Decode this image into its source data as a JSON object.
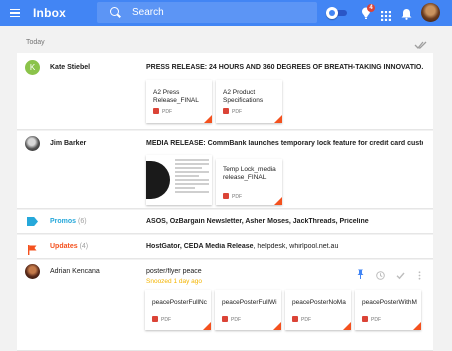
{
  "app": {
    "title": "Inbox",
    "search_placeholder": "Search",
    "badge_count": "4"
  },
  "section": {
    "label": "Today"
  },
  "rows": [
    {
      "sender": "Kate Stiebel",
      "avatar_letter": "K",
      "subject": "PRESS RELEASE: 24 HOURS AND 360 DEGREES OF BREATH-TAKING INNOVATIO...",
      "attachments": [
        {
          "name": "A2 Press Release_FINAL",
          "type": "PDF"
        },
        {
          "name": "A2 Product Specifications",
          "type": "PDF"
        }
      ]
    },
    {
      "sender": "Jim Barker",
      "subject": "MEDIA RELEASE: CommBank launches temporary lock feature for credit card custom...",
      "attachments": [
        {
          "name": "Temp Lock_media release_FINAL",
          "type": "PDF"
        }
      ]
    },
    {
      "category": "Promos",
      "count": "(6)",
      "summary": "ASOS, OzBargain Newsletter, Asher Moses, JackThreads, Priceline"
    },
    {
      "category": "Updates",
      "count": "(4)",
      "summary_bold": "HostGator, CEDA Media Release",
      "summary_rest": ", helpdesk, whirlpool.net.au"
    },
    {
      "sender": "Adrian Kencana",
      "subject": "poster/flyer peace",
      "snoozed": "Snoozed 1 day ago",
      "attachments": [
        {
          "name": "peacePosterFullNc",
          "type": "PDF"
        },
        {
          "name": "peacePosterFullWi",
          "type": "PDF"
        },
        {
          "name": "peacePosterNoMa",
          "type": "PDF"
        },
        {
          "name": "peacePosterWithM",
          "type": "PDF"
        }
      ]
    }
  ],
  "colors": {
    "header": "#4285f4",
    "promos": "#26a8da",
    "updates": "#f4511e",
    "snoozed": "#f4b400",
    "pdf": "#db4437"
  },
  "icons": [
    "menu-icon",
    "search-icon",
    "toggle-icon",
    "reminder-icon",
    "apps-icon",
    "bell-icon",
    "done-all-icon",
    "tag-icon",
    "flag-icon",
    "pin-icon",
    "clock-icon",
    "check-icon",
    "more-icon"
  ]
}
